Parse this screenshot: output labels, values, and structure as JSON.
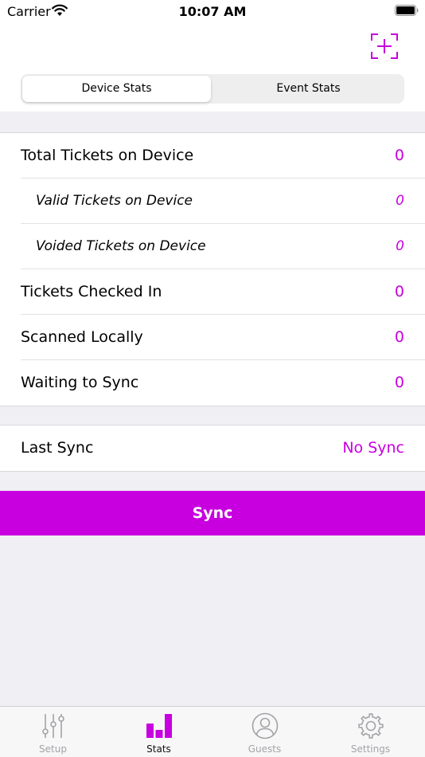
{
  "status_bar": {
    "carrier": "Carrier",
    "time": "10:07 AM"
  },
  "colors": {
    "accent": "#c800e0",
    "background": "#efeff4",
    "tab_inactive": "#a3a3a8"
  },
  "segments": [
    {
      "label": "Device Stats",
      "selected": true
    },
    {
      "label": "Event Stats",
      "selected": false
    }
  ],
  "stats": [
    {
      "label": "Total Tickets on Device",
      "value": "0"
    },
    {
      "label": "Valid Tickets on Device",
      "value": "0"
    },
    {
      "label": "Voided Tickets on Device",
      "value": "0"
    },
    {
      "label": "Tickets Checked In",
      "value": "0"
    },
    {
      "label": "Scanned Locally",
      "value": "0"
    },
    {
      "label": "Waiting to Sync",
      "value": "0"
    }
  ],
  "last_sync": {
    "label": "Last Sync",
    "value": "No Sync"
  },
  "sync_button": {
    "label": "Sync"
  },
  "tabs": [
    {
      "label": "Setup",
      "icon": "sliders-icon"
    },
    {
      "label": "Stats",
      "icon": "bar-chart-icon",
      "active": true
    },
    {
      "label": "Guests",
      "icon": "person-circle-icon"
    },
    {
      "label": "Settings",
      "icon": "gear-icon"
    }
  ]
}
